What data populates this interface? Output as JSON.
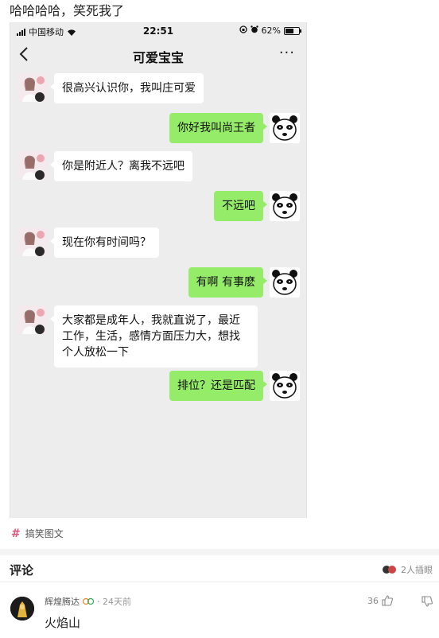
{
  "post": {
    "title": "哈哈哈哈，笑死我了"
  },
  "statusbar": {
    "carrier": "中国移动",
    "time": "22:51",
    "battery": "62%"
  },
  "chat": {
    "title": "可爱宝宝",
    "back_icon": "chevron-left-icon",
    "more_icon": "more-dots-icon",
    "more_label": "···",
    "messages": [
      {
        "side": "in",
        "text": "很高兴认识你，我叫庄可爱"
      },
      {
        "side": "out",
        "text": "你好我叫尚王者"
      },
      {
        "side": "in",
        "text": "你是附近人？离我不远吧"
      },
      {
        "side": "out",
        "text": "不远吧"
      },
      {
        "side": "in",
        "text": "现在你有时间吗？"
      },
      {
        "side": "out",
        "text": "有啊 有事麽"
      },
      {
        "side": "in",
        "text": "大家都是成年人，我就直说了，最近工作，生活，感情方面压力大，想找个人放松一下"
      },
      {
        "side": "out",
        "text": "排位？还是匹配"
      }
    ]
  },
  "tag": {
    "hash": "#",
    "label": "搞笑图文"
  },
  "comments": {
    "label": "评论",
    "viewers": "2人插眼",
    "items": [
      {
        "user": "辉煌腾达",
        "time": "· 24天前",
        "likes": "36",
        "text": "火焰山"
      }
    ]
  },
  "colors": {
    "bubble_out": "#95ec69",
    "bubble_in": "#ffffff",
    "chat_bg": "#ededed",
    "tag_hash": "#e0567a"
  }
}
